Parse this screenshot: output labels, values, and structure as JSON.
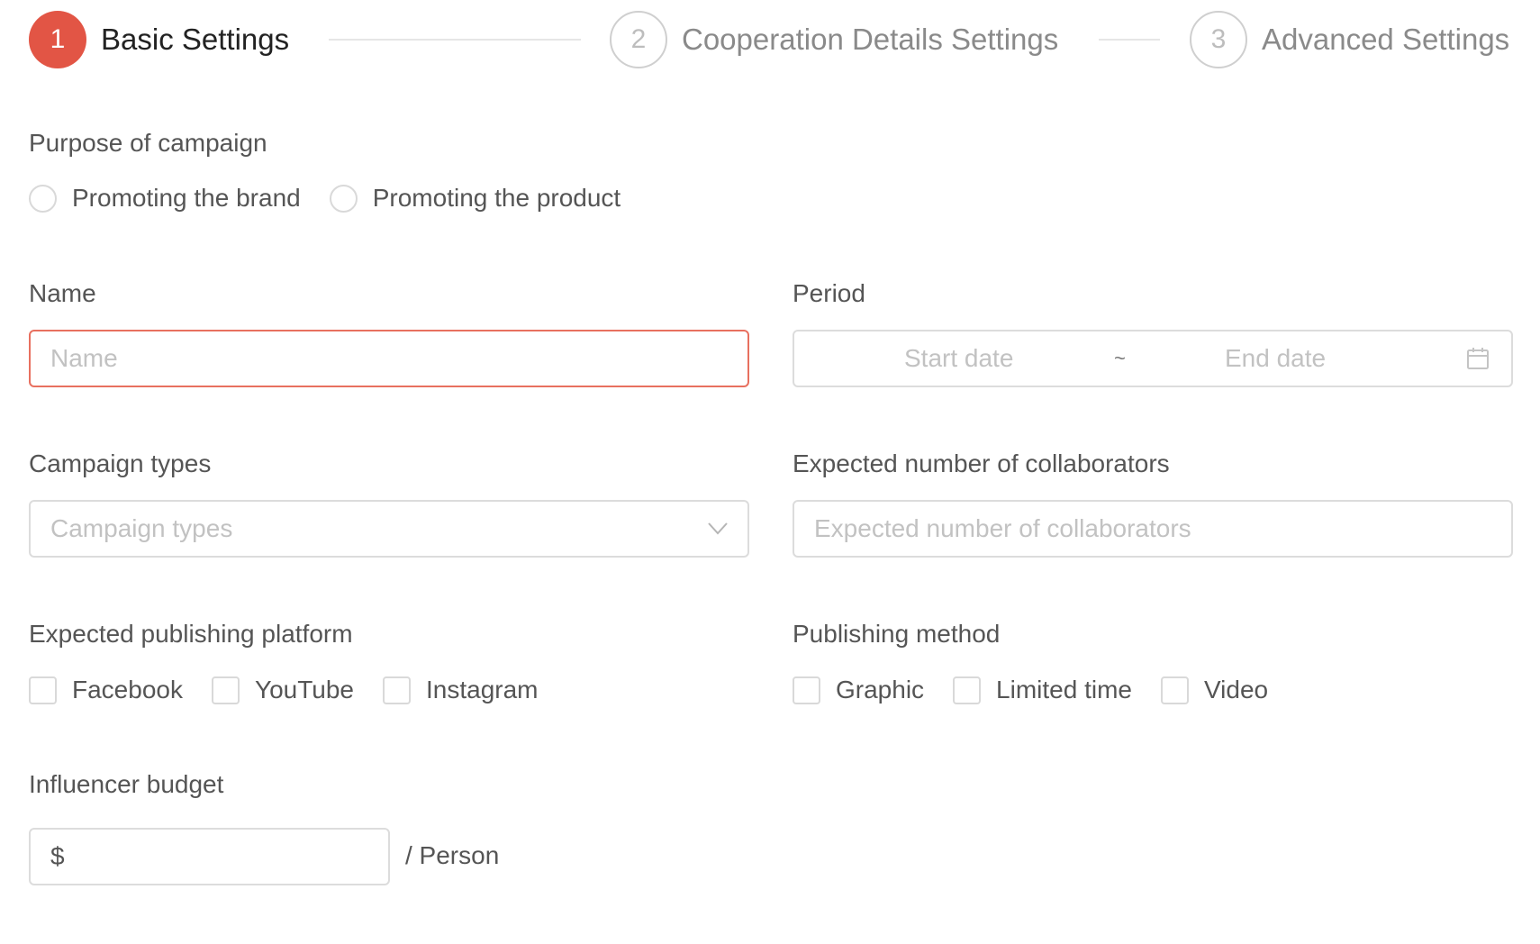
{
  "steps": [
    {
      "number": "1",
      "title": "Basic Settings",
      "state": "active"
    },
    {
      "number": "2",
      "title": "Cooperation Details Settings",
      "state": "inactive"
    },
    {
      "number": "3",
      "title": "Advanced Settings",
      "state": "inactive"
    }
  ],
  "colors": {
    "accent": "#e25545",
    "error_border": "#e8705f",
    "border": "#dcdcdc",
    "label": "#555555",
    "placeholder": "#c2c2c2"
  },
  "purpose": {
    "label": "Purpose of campaign",
    "options": [
      {
        "label": "Promoting the brand",
        "checked": false
      },
      {
        "label": "Promoting the product",
        "checked": false
      }
    ]
  },
  "name": {
    "label": "Name",
    "placeholder": "Name",
    "value": ""
  },
  "period": {
    "label": "Period",
    "start_placeholder": "Start date",
    "separator": "~",
    "end_placeholder": "End date",
    "icon": "calendar-icon"
  },
  "campaign_types": {
    "label": "Campaign types",
    "placeholder": "Campaign types",
    "icon": "chevron-down-icon"
  },
  "collaborators": {
    "label": "Expected number of collaborators",
    "placeholder": "Expected number of collaborators",
    "value": ""
  },
  "platform": {
    "label": "Expected publishing platform",
    "options": [
      {
        "label": "Facebook",
        "checked": false
      },
      {
        "label": "YouTube",
        "checked": false
      },
      {
        "label": "Instagram",
        "checked": false
      }
    ]
  },
  "method": {
    "label": "Publishing method",
    "options": [
      {
        "label": "Graphic",
        "checked": false
      },
      {
        "label": "Limited time",
        "checked": false
      },
      {
        "label": "Video",
        "checked": false
      }
    ]
  },
  "budget": {
    "label": "Influencer budget",
    "prefix": "$",
    "value": "",
    "unit": "/ Person"
  }
}
